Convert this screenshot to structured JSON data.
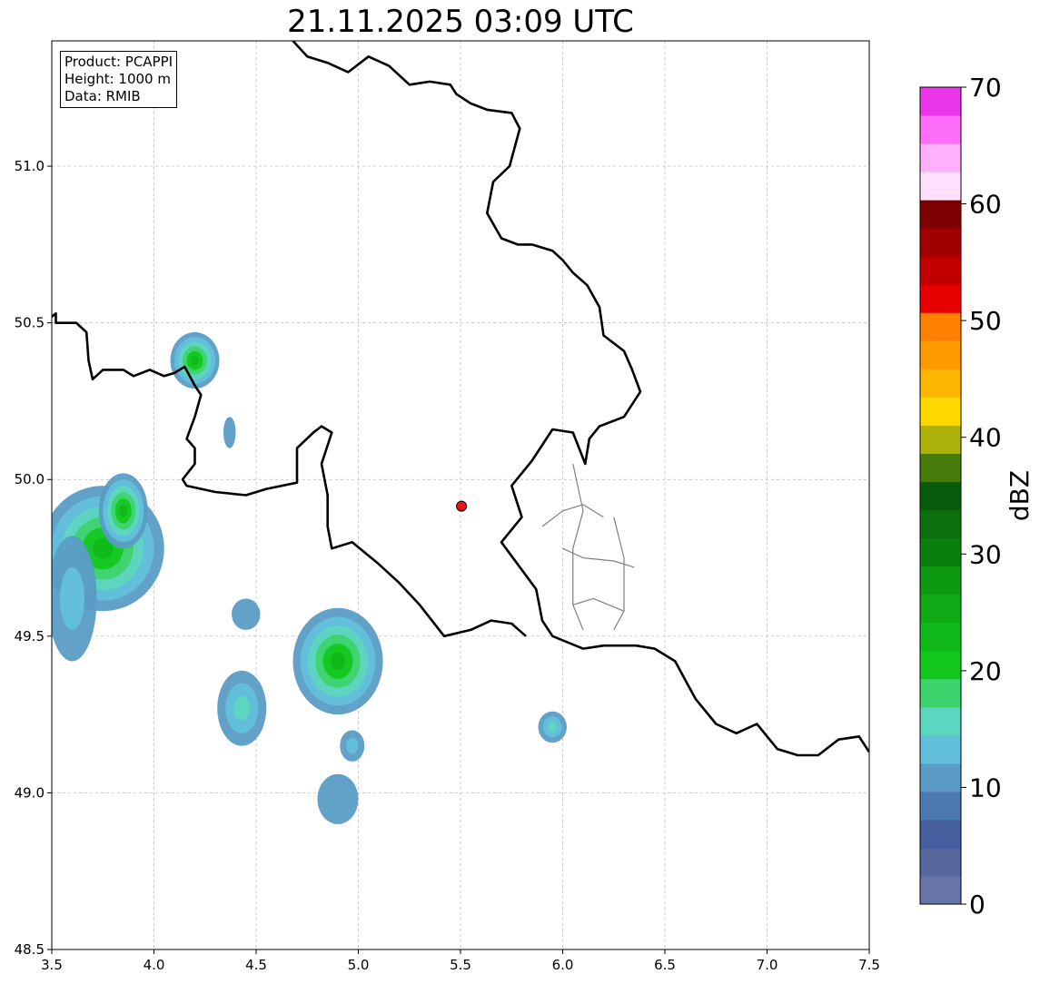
{
  "title": "21.11.2025 03:09 UTC",
  "info": {
    "product": "Product: PCAPPI",
    "height": "Height: 1000 m",
    "source": "Data: RMIB"
  },
  "map": {
    "lon_range": [
      3.5,
      7.5
    ],
    "lat_range": [
      48.5,
      51.4
    ],
    "lon_ticks": [
      3.5,
      4.0,
      4.5,
      5.0,
      5.5,
      6.0,
      6.5,
      7.0,
      7.5
    ],
    "lon_tick_labels": [
      "3.5",
      "4.0",
      "4.5",
      "5.0",
      "5.5",
      "6.0",
      "6.5",
      "7.0",
      "7.5"
    ],
    "lat_ticks": [
      48.5,
      49.0,
      49.5,
      50.0,
      50.5,
      51.0
    ],
    "lat_tick_labels": [
      "48.5",
      "49.0",
      "49.5",
      "50.0",
      "50.5",
      "51.0"
    ],
    "grid": true,
    "radar_site": {
      "lon": 5.505,
      "lat": 49.915,
      "color": "#e8141a"
    },
    "borders": {
      "west_segment": [
        [
          3.5,
          50.52
        ],
        [
          3.52,
          50.53
        ],
        [
          3.52,
          50.5
        ],
        [
          3.62,
          50.5
        ],
        [
          3.67,
          50.47
        ],
        [
          3.68,
          50.38
        ],
        [
          3.7,
          50.32
        ],
        [
          3.75,
          50.35
        ],
        [
          3.85,
          50.35
        ],
        [
          3.9,
          50.33
        ],
        [
          3.98,
          50.35
        ],
        [
          4.05,
          50.33
        ],
        [
          4.1,
          50.34
        ],
        [
          4.15,
          50.36
        ],
        [
          4.2,
          50.3
        ],
        [
          4.23,
          50.27
        ],
        [
          4.2,
          50.2
        ],
        [
          4.16,
          50.13
        ],
        [
          4.2,
          50.1
        ],
        [
          4.2,
          50.05
        ],
        [
          4.14,
          50.0
        ],
        [
          4.16,
          49.98
        ],
        [
          4.3,
          49.96
        ],
        [
          4.45,
          49.95
        ],
        [
          4.55,
          49.97
        ],
        [
          4.7,
          49.99
        ],
        [
          4.7,
          50.1
        ],
        [
          4.78,
          50.15
        ],
        [
          4.82,
          50.17
        ],
        [
          4.87,
          50.15
        ],
        [
          4.82,
          50.05
        ],
        [
          4.85,
          49.95
        ],
        [
          4.85,
          49.85
        ],
        [
          4.87,
          49.78
        ],
        [
          4.97,
          49.8
        ],
        [
          5.1,
          49.73
        ],
        [
          5.2,
          49.67
        ],
        [
          5.3,
          49.6
        ],
        [
          5.42,
          49.5
        ],
        [
          5.55,
          49.52
        ],
        [
          5.65,
          49.55
        ],
        [
          5.75,
          49.54
        ],
        [
          5.82,
          49.5
        ]
      ],
      "east_segment": [
        [
          4.68,
          51.4
        ],
        [
          4.75,
          51.35
        ],
        [
          4.85,
          51.33
        ],
        [
          4.95,
          51.3
        ],
        [
          5.05,
          51.35
        ],
        [
          5.15,
          51.32
        ],
        [
          5.25,
          51.26
        ],
        [
          5.35,
          51.27
        ],
        [
          5.45,
          51.26
        ],
        [
          5.48,
          51.23
        ],
        [
          5.55,
          51.2
        ],
        [
          5.63,
          51.18
        ],
        [
          5.75,
          51.17
        ],
        [
          5.79,
          51.12
        ],
        [
          5.74,
          51.0
        ],
        [
          5.66,
          50.95
        ],
        [
          5.63,
          50.85
        ],
        [
          5.7,
          50.77
        ],
        [
          5.78,
          50.75
        ],
        [
          5.85,
          50.75
        ],
        [
          5.95,
          50.73
        ],
        [
          6.0,
          50.7
        ],
        [
          6.05,
          50.66
        ],
        [
          6.12,
          50.62
        ],
        [
          6.18,
          50.55
        ],
        [
          6.2,
          50.46
        ],
        [
          6.3,
          50.41
        ],
        [
          6.34,
          50.35
        ],
        [
          6.38,
          50.28
        ],
        [
          6.3,
          50.2
        ],
        [
          6.18,
          50.17
        ],
        [
          6.13,
          50.13
        ],
        [
          6.11,
          50.05
        ],
        [
          6.05,
          50.15
        ],
        [
          5.95,
          50.16
        ],
        [
          5.85,
          50.06
        ],
        [
          5.75,
          49.98
        ],
        [
          5.8,
          49.88
        ],
        [
          5.7,
          49.8
        ],
        [
          5.87,
          49.65
        ],
        [
          5.9,
          49.55
        ],
        [
          5.95,
          49.5
        ],
        [
          6.1,
          49.46
        ],
        [
          6.2,
          49.47
        ],
        [
          6.36,
          49.47
        ],
        [
          6.45,
          49.46
        ],
        [
          6.55,
          49.42
        ],
        [
          6.6,
          49.36
        ],
        [
          6.65,
          49.3
        ],
        [
          6.75,
          49.22
        ],
        [
          6.85,
          49.19
        ],
        [
          6.95,
          49.22
        ],
        [
          7.05,
          49.14
        ],
        [
          7.15,
          49.12
        ],
        [
          7.25,
          49.12
        ],
        [
          7.35,
          49.17
        ],
        [
          7.45,
          49.18
        ],
        [
          7.5,
          49.13
        ]
      ],
      "lux_district_lines": [
        [
          [
            5.9,
            49.85
          ],
          [
            6.0,
            49.9
          ],
          [
            6.1,
            49.92
          ],
          [
            6.2,
            49.88
          ]
        ],
        [
          [
            6.0,
            49.78
          ],
          [
            6.1,
            49.75
          ],
          [
            6.25,
            49.74
          ],
          [
            6.35,
            49.72
          ]
        ],
        [
          [
            6.05,
            49.6
          ],
          [
            6.15,
            49.62
          ],
          [
            6.3,
            49.58
          ]
        ],
        [
          [
            6.05,
            50.05
          ],
          [
            6.1,
            49.9
          ],
          [
            6.05,
            49.78
          ],
          [
            6.05,
            49.6
          ],
          [
            6.1,
            49.52
          ]
        ],
        [
          [
            6.25,
            49.88
          ],
          [
            6.3,
            49.75
          ],
          [
            6.3,
            49.58
          ],
          [
            6.25,
            49.52
          ]
        ]
      ]
    },
    "echo_cells": [
      {
        "lon": 3.75,
        "lat": 49.78,
        "rx_deg": 0.3,
        "ry_deg": 0.2,
        "peak_dbz": 22
      },
      {
        "lon": 3.6,
        "lat": 49.62,
        "rx_deg": 0.12,
        "ry_deg": 0.2,
        "peak_dbz": 14
      },
      {
        "lon": 3.85,
        "lat": 49.9,
        "rx_deg": 0.12,
        "ry_deg": 0.12,
        "peak_dbz": 23
      },
      {
        "lon": 4.2,
        "lat": 50.38,
        "rx_deg": 0.12,
        "ry_deg": 0.09,
        "peak_dbz": 22
      },
      {
        "lon": 4.37,
        "lat": 50.15,
        "rx_deg": 0.03,
        "ry_deg": 0.05,
        "peak_dbz": 12
      },
      {
        "lon": 4.45,
        "lat": 49.57,
        "rx_deg": 0.07,
        "ry_deg": 0.05,
        "peak_dbz": 12
      },
      {
        "lon": 4.9,
        "lat": 49.42,
        "rx_deg": 0.22,
        "ry_deg": 0.17,
        "peak_dbz": 23
      },
      {
        "lon": 4.43,
        "lat": 49.27,
        "rx_deg": 0.12,
        "ry_deg": 0.12,
        "peak_dbz": 15
      },
      {
        "lon": 4.97,
        "lat": 49.15,
        "rx_deg": 0.06,
        "ry_deg": 0.05,
        "peak_dbz": 13
      },
      {
        "lon": 4.9,
        "lat": 48.98,
        "rx_deg": 0.1,
        "ry_deg": 0.08,
        "peak_dbz": 12
      },
      {
        "lon": 5.95,
        "lat": 49.21,
        "rx_deg": 0.07,
        "ry_deg": 0.05,
        "peak_dbz": 15
      }
    ]
  },
  "colorbar": {
    "label": "dBZ",
    "min": 0,
    "max": 70,
    "ticks": [
      0,
      10,
      20,
      30,
      40,
      50,
      60,
      70
    ],
    "tick_labels": [
      "0",
      "10",
      "20",
      "30",
      "40",
      "50",
      "60",
      "70"
    ],
    "colors": [
      "#6674a8",
      "#55679c",
      "#445e9e",
      "#4b79b0",
      "#5a9cc5",
      "#63c0dc",
      "#5dd6c0",
      "#3dd46d",
      "#12c81f",
      "#10b91a",
      "#0fa915",
      "#0d9812",
      "#0a7f0e",
      "#0a6f0d",
      "#075b0a",
      "#477c0c",
      "#adb20a",
      "#ffd800",
      "#ffb600",
      "#ff9b00",
      "#ff7f00",
      "#e60000",
      "#c30000",
      "#a20000",
      "#7e0000",
      "#ffe0fd",
      "#ffb0fd",
      "#ff6ef8",
      "#ec36ec"
    ]
  }
}
